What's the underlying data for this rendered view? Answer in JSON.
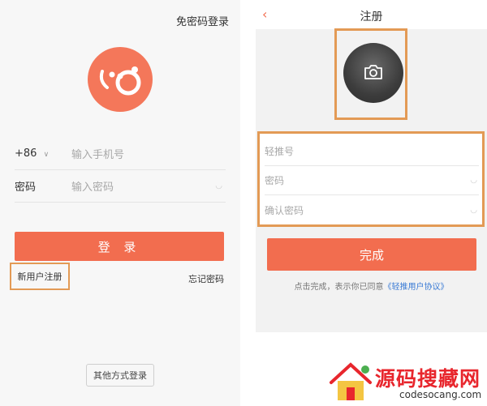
{
  "login_screen": {
    "top_link": "免密码登录",
    "country_code": "+86",
    "phone_placeholder": "输入手机号",
    "password_label": "密码",
    "password_placeholder": "输入密码",
    "login_button": "登 录",
    "register_link": "新用户注册",
    "forgot_link": "忘记密码",
    "other_login_button": "其他方式登录"
  },
  "register_screen": {
    "back_icon": "chevron-left",
    "title": "注册",
    "avatar_icon": "camera",
    "fields": [
      {
        "placeholder": "轻推号"
      },
      {
        "placeholder": "密码"
      },
      {
        "placeholder": "确认密码"
      }
    ],
    "done_button": "完成",
    "agreement_prefix": "点击完成，表示你已同意",
    "agreement_link": "《轻推用户协议》"
  },
  "watermark": {
    "title": "源码搜藏网",
    "domain": "codesocang.com"
  },
  "colors": {
    "accent": "#f26d4f",
    "logo": "#f4775a",
    "highlight_border": "#e39a55",
    "link_blue": "#3a7bd5",
    "watermark_red": "#e8262d"
  }
}
